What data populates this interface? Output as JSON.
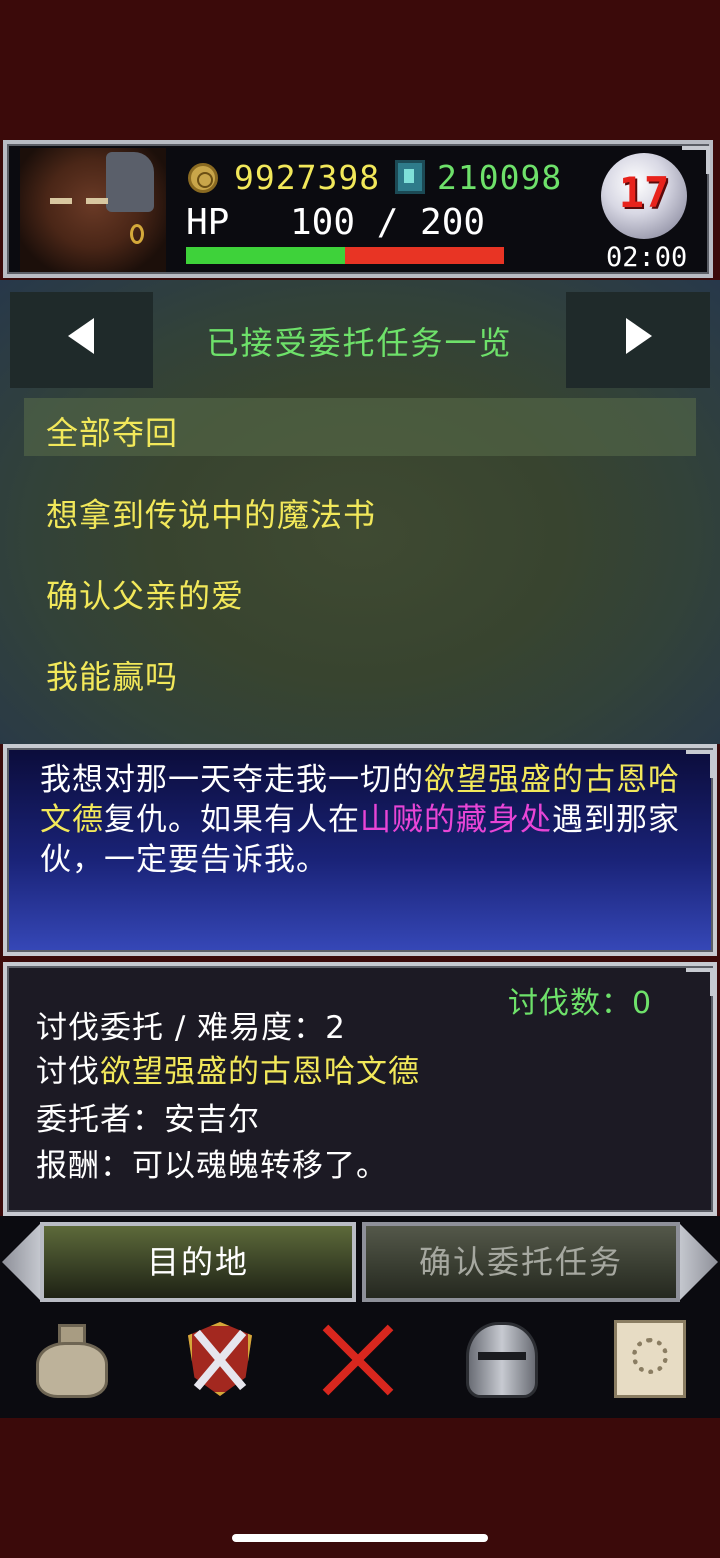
{
  "status": {
    "gold": "9927398",
    "souls": "210098",
    "hp_label": "HP",
    "hp_value": "100 / 200",
    "hp_fraction": 0.5,
    "day": "17",
    "time": "02:00"
  },
  "header": {
    "title": "已接受委托任务一览"
  },
  "quests": [
    {
      "label": "全部夺回",
      "selected": true
    },
    {
      "label": "想拿到传说中的魔法书",
      "selected": false
    },
    {
      "label": "确认父亲的爱",
      "selected": false
    },
    {
      "label": "我能赢吗",
      "selected": false
    }
  ],
  "description": {
    "p1": "我想对那一天夺走我一切的",
    "p2": "欲望强盛的古恩哈文德",
    "p3": "复仇。如果有人在",
    "p4": "山贼的藏身处",
    "p5": "遇到那家伙，一定要告诉我。"
  },
  "info": {
    "kill_count": "讨伐数：0",
    "type_line": "讨伐委托 / 难易度：2",
    "target_prefix": "讨伐",
    "target_name": "欲望强盛的古恩哈文德",
    "client_line": "委托者：安吉尔",
    "reward_line": "报酬：可以魂魄转移了。"
  },
  "buttons": {
    "destination": "目的地",
    "confirm": "确认委托任务"
  },
  "menu": [
    "bag-icon",
    "emblem-icon",
    "close-icon",
    "helmet-icon",
    "scroll-icon"
  ],
  "colors": {
    "quest_text": "#f2e85a",
    "highlight_pink": "#e845d6",
    "accent_green": "#6ee16a",
    "hp_green": "#3ed23a",
    "hp_red": "#e83424"
  }
}
